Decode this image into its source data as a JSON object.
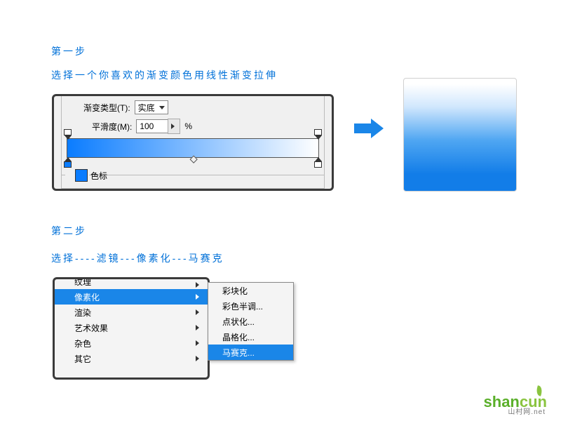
{
  "step1": {
    "title": "第一步",
    "desc": "选择一个你喜欢的渐变颜色用线性渐变拉伸"
  },
  "gradient_editor": {
    "type_label": "渐变类型(T):",
    "type_value": "实底",
    "smooth_label": "平滑度(M):",
    "smooth_value": "100",
    "smooth_unit": "%",
    "swatch_label": "色标"
  },
  "step2": {
    "title": "第二步",
    "desc": "选择----滤镜---像素化---马赛克"
  },
  "filter_menu": {
    "items": [
      "纹理",
      "像素化",
      "渲染",
      "艺术效果",
      "杂色",
      "其它"
    ],
    "selected_index": 1
  },
  "submenu": {
    "items": [
      "彩块化",
      "彩色半调...",
      "点状化...",
      "晶格化...",
      "马赛克..."
    ],
    "selected_index": 4
  },
  "watermark": {
    "text_a": "shan",
    "text_b": "cun",
    "sub": "山村网.net"
  }
}
